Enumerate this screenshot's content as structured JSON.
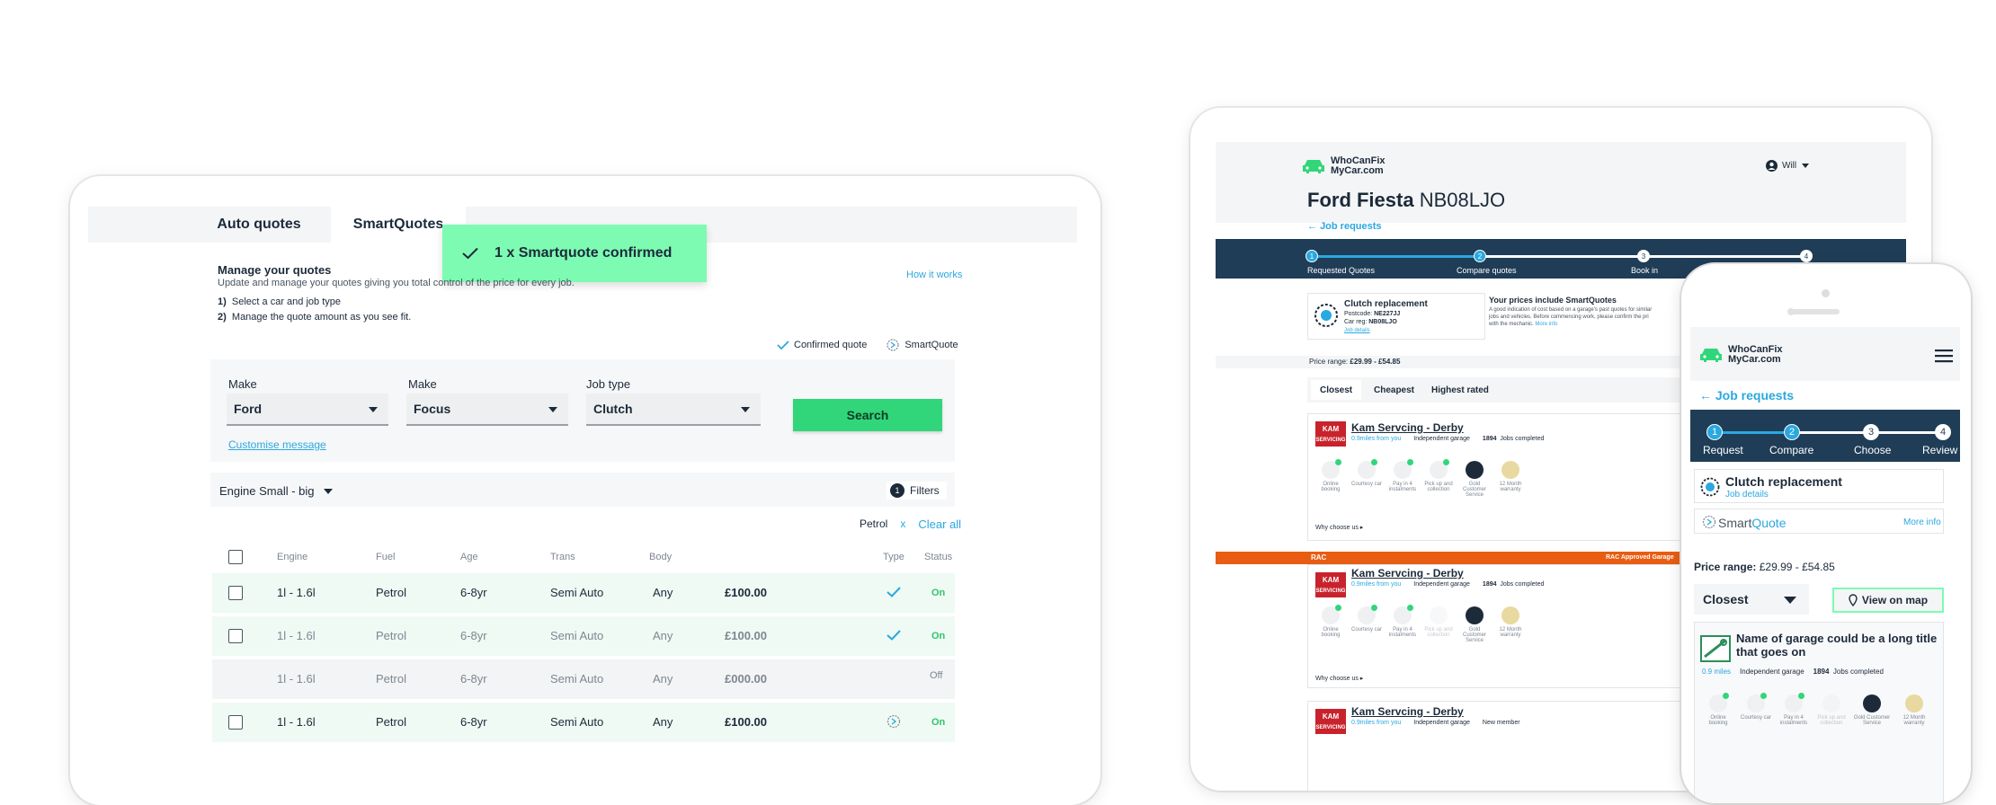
{
  "laptop": {
    "tabs": [
      "Auto quotes",
      "SmartQuotes"
    ],
    "toast": "1 x Smartquote confirmed",
    "manage_title": "Manage your quotes",
    "manage_desc": "Update and manage your quotes giving you total control of the price for every job.",
    "how_it_works": "How it works",
    "steps": [
      {
        "num": "1)",
        "text": "Select a car and job type"
      },
      {
        "num": "2)",
        "text": "Manage the quote amount as you see fit."
      }
    ],
    "legend": {
      "confirmed": "Confirmed quote",
      "smart": "SmartQuote"
    },
    "filters": {
      "make1_label": "Make",
      "make1_value": "Ford",
      "make2_label": "Make",
      "make2_value": "Focus",
      "job_label": "Job type",
      "job_value": "Clutch",
      "search": "Search",
      "customise": "Customise message"
    },
    "engine_dropdown": "Engine Small - big",
    "filters_count": "1",
    "filters_label": "Filters",
    "chip": "Petrol",
    "chip_x": "x",
    "clear_all": "Clear all",
    "table_headers": {
      "engine": "Engine",
      "fuel": "Fuel",
      "age": "Age",
      "trans": "Trans",
      "body": "Body",
      "type": "Type",
      "status": "Status"
    },
    "rows": [
      {
        "engine": "1l - 1.6l",
        "fuel": "Petrol",
        "age": "6-8yr",
        "trans": "Semi Auto",
        "body": "Any",
        "price": "£100.00",
        "status": "On"
      },
      {
        "engine": "1l - 1.6l",
        "fuel": "Petrol",
        "age": "6-8yr",
        "trans": "Semi Auto",
        "body": "Any",
        "price": "£100.00",
        "status": "On"
      },
      {
        "engine": "1l - 1.6l",
        "fuel": "Petrol",
        "age": "6-8yr",
        "trans": "Semi Auto",
        "body": "Any",
        "price": "£000.00",
        "status": "Off"
      },
      {
        "engine": "1l - 1.6l",
        "fuel": "Petrol",
        "age": "6-8yr",
        "trans": "Semi Auto",
        "body": "Any",
        "price": "£100.00",
        "status": "On"
      }
    ]
  },
  "tablet": {
    "logo_line1": "WhoCanFix",
    "logo_line2": "MyCar.com",
    "user": "Will",
    "car_model": "Ford Fiesta",
    "car_reg": "NB08LJO",
    "back": "Job requests",
    "steps": [
      {
        "num": "1",
        "label": "Requested Quotes"
      },
      {
        "num": "2",
        "label": "Compare quotes"
      },
      {
        "num": "3",
        "label": "Book in"
      },
      {
        "num": "4",
        "label": ""
      }
    ],
    "job_title": "Clutch replacement",
    "postcode_label": "Postcode:",
    "postcode": "NE227JJ",
    "carreg_label": "Car reg:",
    "carreg": "NB08LJO",
    "job_details": "Job details",
    "info_title": "Your prices include SmartQuotes",
    "info_text1": "A good indication of cost based on a garage's past quotes for similar",
    "info_text2": "jobs and vehicles. Before commencing work, please confirm the pri",
    "info_text3": "with the mechanic.",
    "more_info": "More info",
    "price_range_label": "Price range:",
    "price_range": "£29.99 - £54.85",
    "sort_tabs": [
      "Closest",
      "Cheapest",
      "Highest rated"
    ],
    "garages": [
      {
        "name": "Kam Servcing - Derby",
        "distance": "0.9miles from you",
        "type": "Independent garage",
        "jobs_num": "1894",
        "jobs_label": "Jobs completed",
        "why": "Why choose us"
      },
      {
        "name": "Kam Servcing - Derby",
        "distance": "0.9miles from you",
        "type": "Independent garage",
        "jobs_num": "1894",
        "jobs_label": "Jobs completed",
        "why": "Why choose us"
      },
      {
        "name": "Kam Servcing - Derby",
        "distance": "0.9miles from you",
        "type": "Independent garage",
        "jobs_num": "",
        "jobs_label": "New member",
        "why": ""
      }
    ],
    "rac_label": "RAC",
    "rac_approved": "RAC Approved Garage",
    "features": [
      "Online booking",
      "Courtesy car",
      "Pay in 4 instalments",
      "Pick up and collection",
      "Gold Customer Service",
      "12 Month warranty"
    ],
    "kam_logo": [
      "KAM",
      "SERVICING"
    ]
  },
  "phone": {
    "logo_line1": "WhoCanFix",
    "logo_line2": "MyCar.com",
    "back": "Job requests",
    "steps": [
      {
        "num": "1",
        "label": "Request"
      },
      {
        "num": "2",
        "label": "Compare"
      },
      {
        "num": "3",
        "label": "Choose"
      },
      {
        "num": "4",
        "label": "Review"
      }
    ],
    "job_title": "Clutch replacement",
    "job_details": "Job details",
    "smart": "Smart",
    "quote": "Quote",
    "more_info": "More info",
    "price_range_label": "Price range:",
    "price_range": "£29.99 - £54.85",
    "sort": "Closest",
    "view_map": "View on map",
    "garage_name": "Name of garage could be a long title that goes on",
    "distance": "0.9 miles",
    "type": "Independent garage",
    "jobs_num": "1894",
    "jobs_label": "Jobs completed",
    "features": [
      "Online booking",
      "Courtesy car",
      "Pay in 4 instalments",
      "Pick up and collection",
      "Gold Customer Service",
      "12 Month warranty"
    ]
  },
  "colors": {
    "accent": "#2aa8e0",
    "green": "#31d67a",
    "navy": "#1f3d57",
    "toast": "#7dfbb2",
    "rac": "#e85d12"
  }
}
